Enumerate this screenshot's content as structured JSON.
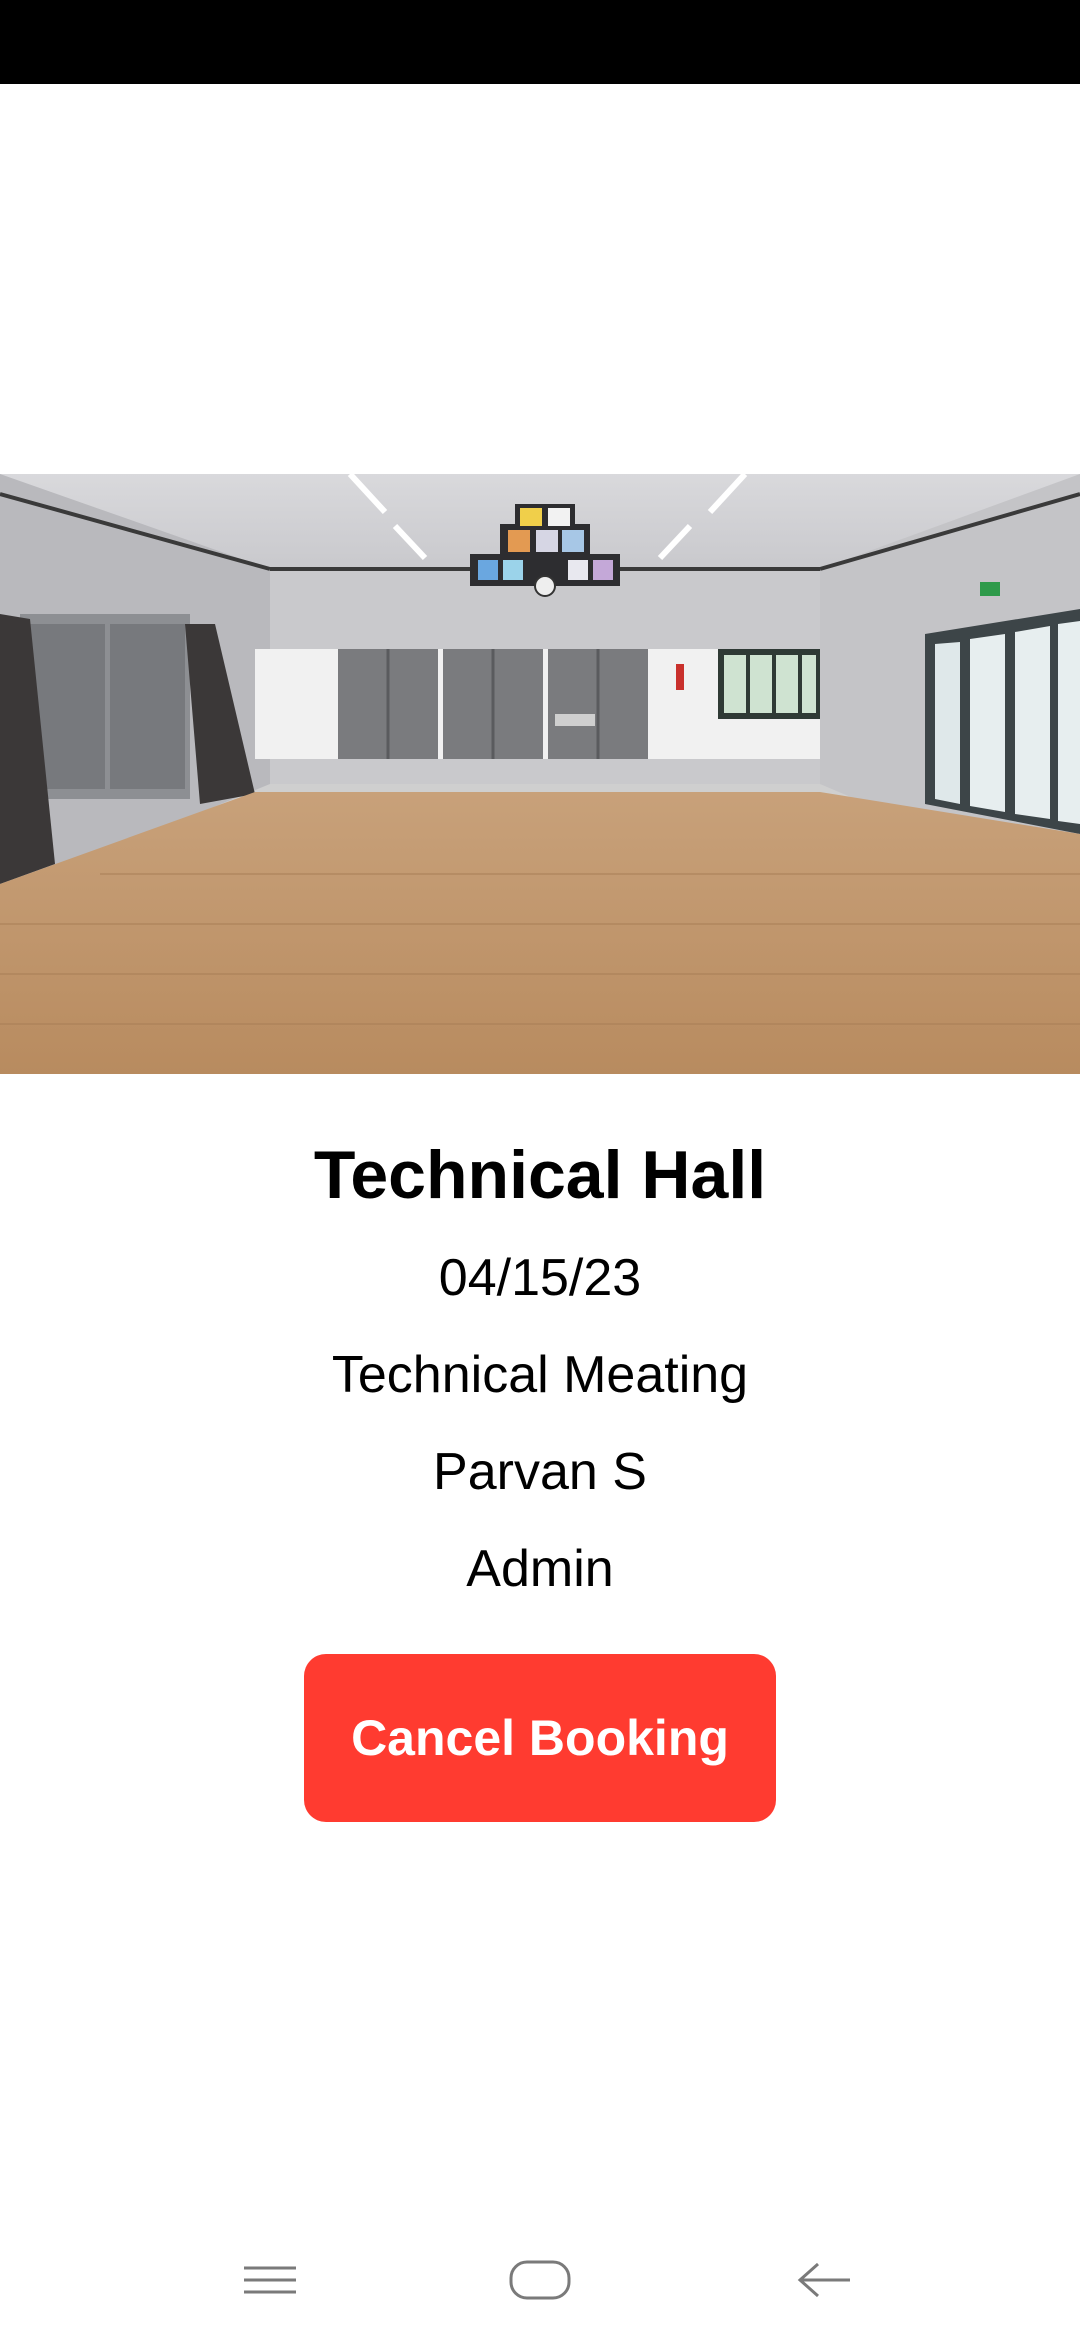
{
  "booking": {
    "hall_name": "Technical Hall",
    "date": "04/15/23",
    "purpose": "Technical Meating",
    "booked_by": "Parvan S",
    "role": "Admin",
    "cancel_label": "Cancel Booking"
  },
  "colors": {
    "cancel_button": "#ff3b30",
    "nav_icon": "#7a7a7a"
  },
  "icons": {
    "hero_image": "hall-photo",
    "nav_menu": "menu-icon",
    "nav_home": "home-icon",
    "nav_back": "back-icon"
  }
}
